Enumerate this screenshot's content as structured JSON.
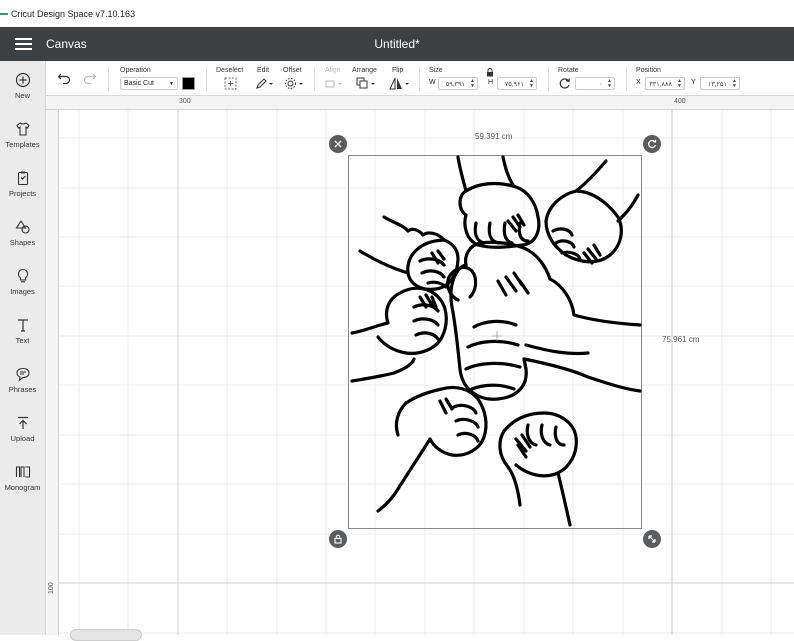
{
  "app": {
    "titlebar_text": "Cricut Design Space  v7.10.163"
  },
  "header": {
    "canvas_label": "Canvas",
    "doc_title": "Untitled*"
  },
  "sidebar": {
    "items": [
      {
        "label": "New",
        "icon": "plus-circle-icon"
      },
      {
        "label": "Templates",
        "icon": "shirt-icon"
      },
      {
        "label": "Projects",
        "icon": "clipboard-icon"
      },
      {
        "label": "Shapes",
        "icon": "shapes-icon"
      },
      {
        "label": "Images",
        "icon": "bulb-icon"
      },
      {
        "label": "Text",
        "icon": "text-icon"
      },
      {
        "label": "Phrases",
        "icon": "speech-bubble-icon"
      },
      {
        "label": "Upload",
        "icon": "upload-icon"
      },
      {
        "label": "Monogram",
        "icon": "monogram-icon"
      }
    ]
  },
  "toolbar": {
    "operation_label": "Operation",
    "operation_value": "Basic Cut",
    "color_swatch": "#000000",
    "deselect_label": "Deselect",
    "edit_label": "Edit",
    "offset_label": "Offset",
    "align_label": "Align",
    "arrange_label": "Arrange",
    "flip_label": "Flip",
    "size_label": "Size",
    "w_prefix": "W",
    "w_value": "۵۹,۳۹۱",
    "h_prefix": "H",
    "h_value": "۷۵,۹۶۱",
    "rotate_label": "Rotate",
    "rotate_value": "۰",
    "position_label": "Position",
    "x_prefix": "X",
    "x_value": "۳۳۱,۸۸۸",
    "y_prefix": "Y",
    "y_value": "۱۳,۲۵۱"
  },
  "rulers": {
    "top_300": "300",
    "top_400": "400",
    "left_100": "100"
  },
  "canvas": {
    "width_dim": "59.391 cm",
    "height_dim": "75.961 cm"
  }
}
